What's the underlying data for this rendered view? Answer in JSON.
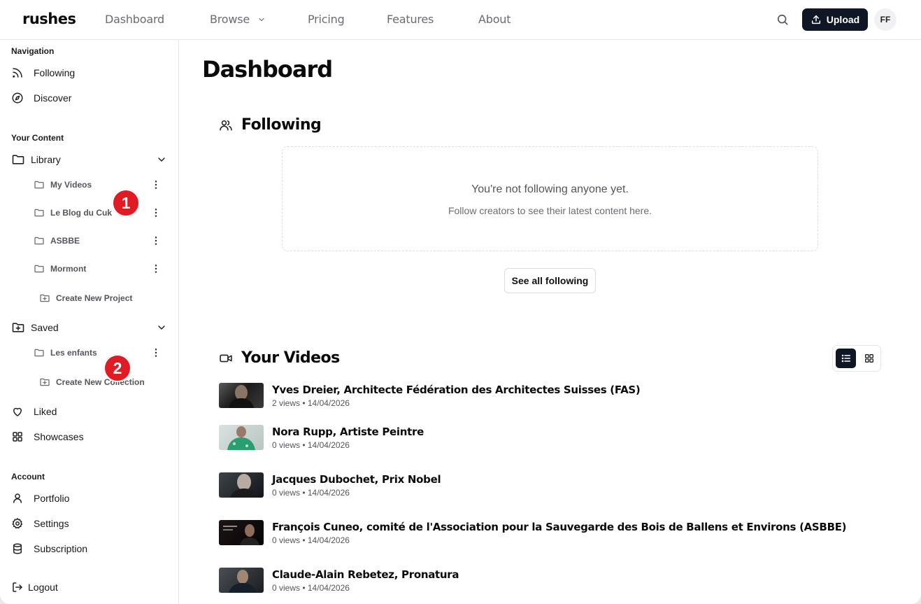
{
  "app": {
    "logo": "rushes"
  },
  "topnav": {
    "links": [
      "Dashboard",
      "Browse",
      "Pricing",
      "Features",
      "About"
    ],
    "upload_label": "Upload",
    "avatar_initials": "FF"
  },
  "sidebar": {
    "navigation_label": "Navigation",
    "following": "Following",
    "discover": "Discover",
    "your_content_label": "Your Content",
    "library": "Library",
    "projects": [
      "My Videos",
      "Le Blog du Cuk",
      "ASBBE",
      "Mormont"
    ],
    "create_project": "Create New Project",
    "saved": "Saved",
    "collections": [
      "Les enfants"
    ],
    "create_collection": "Create New Collection",
    "liked": "Liked",
    "showcases": "Showcases",
    "account_label": "Account",
    "portfolio": "Portfolio",
    "settings": "Settings",
    "subscription": "Subscription",
    "logout": "Logout"
  },
  "badges": [
    "1",
    "2"
  ],
  "main": {
    "title": "Dashboard",
    "following_heading": "Following",
    "empty_title": "You're not following anyone yet.",
    "empty_sub": "Follow creators to see their latest content here.",
    "see_all": "See all following",
    "videos_heading": "Your Videos",
    "videos": [
      {
        "title": "Yves Dreier, Architecte Fédération des Architectes Suisses (FAS)",
        "meta": "2 views • 14/04/2026"
      },
      {
        "title": "Nora Rupp, Artiste Peintre",
        "meta": "0 views • 14/04/2026"
      },
      {
        "title": "Jacques Dubochet, Prix Nobel",
        "meta": "0 views • 14/04/2026"
      },
      {
        "title": "François Cuneo, comité de l'Association pour la Sauvegarde des Bois de Ballens et Environs (ASBBE)",
        "meta": "0 views • 14/04/2026"
      },
      {
        "title": "Claude-Alain Rebetez, Pronatura",
        "meta": "0 views • 14/04/2026"
      }
    ]
  },
  "colors": {
    "primary": "#0f1626",
    "badge": "#e01b24",
    "muted": "#6b6b73"
  }
}
